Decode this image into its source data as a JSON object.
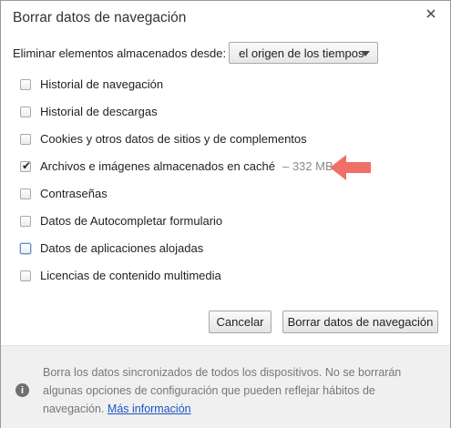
{
  "dialog": {
    "title": "Borrar datos de navegación",
    "close_icon": "close-icon"
  },
  "range": {
    "label": "Eliminar elementos almacenados desde:",
    "selected": "el origen de los tiempos"
  },
  "options": [
    {
      "label": "Historial de navegación",
      "checked": false
    },
    {
      "label": "Historial de descargas",
      "checked": false
    },
    {
      "label": "Cookies y otros datos de sitios y de complementos",
      "checked": false
    },
    {
      "label": "Archivos e imágenes almacenados en caché",
      "size": "– 332 MB",
      "checked": true
    },
    {
      "label": "Contraseñas",
      "checked": false
    },
    {
      "label": "Datos de Autocompletar formulario",
      "checked": false
    },
    {
      "label": "Datos de aplicaciones alojadas",
      "checked": false,
      "focused": true
    },
    {
      "label": "Licencias de contenido multimedia",
      "checked": false
    }
  ],
  "buttons": {
    "cancel": "Cancelar",
    "clear": "Borrar datos de navegación"
  },
  "footer": {
    "text": "Borra los datos sincronizados de todos los dispositivos. No se borrarán algunas opciones de configuración que pueden reflejar hábitos de navegación.",
    "link": "Más información",
    "info_icon": "info-icon"
  },
  "colors": {
    "annotation_arrow": "#f07068",
    "link": "#1a55c4"
  }
}
